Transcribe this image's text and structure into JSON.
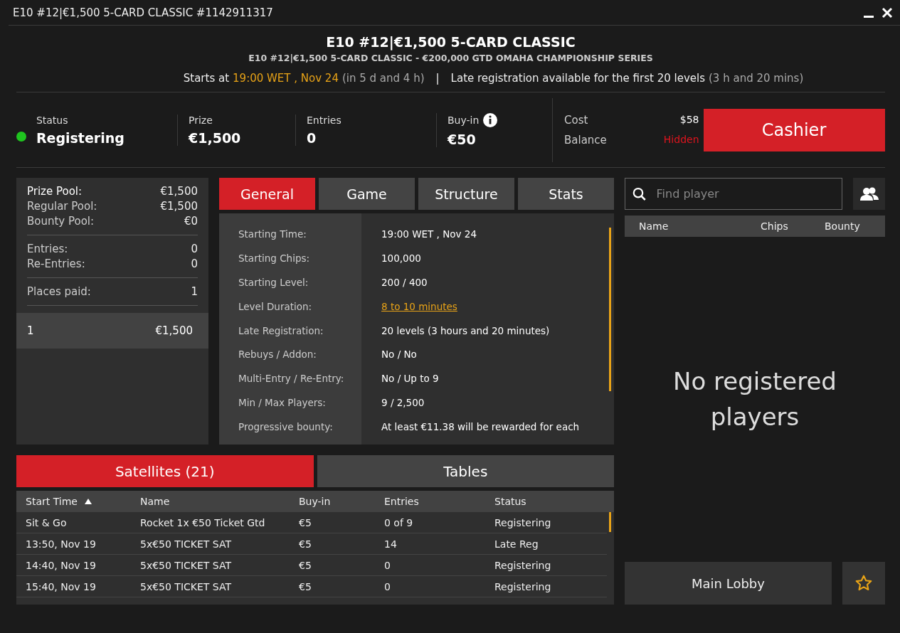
{
  "window": {
    "title": "E10 #12|€1,500 5-CARD CLASSIC #1142911317"
  },
  "header": {
    "title": "E10 #12|€1,500 5-CARD CLASSIC",
    "subtitle": "E10 #12|€1,500 5-CARD CLASSIC - €200,000 GTD OMAHA CHAMPIONSHIP SERIES",
    "starts_label": "Starts at",
    "start_time": "19:00 WET , Nov 24",
    "start_remaining": "(in 5 d and 4 h)",
    "separator": "|",
    "late_reg": "Late registration available for the first 20 levels",
    "late_reg_remaining": "(3 h and 20 mins)"
  },
  "summary": {
    "status": {
      "label": "Status",
      "value": "Registering",
      "color": "#1fc41f"
    },
    "stats": [
      {
        "label": "Prize",
        "value": "€1,500",
        "info": false
      },
      {
        "label": "Entries",
        "value": "0",
        "info": false
      },
      {
        "label": "Buy-in",
        "value": "€50",
        "info": true
      }
    ],
    "cost_label": "Cost",
    "cost_value": "$58",
    "balance_label": "Balance",
    "balance_value": "Hidden",
    "cashier": "Cashier"
  },
  "prize_panel": {
    "groups": [
      [
        {
          "label": "Prize Pool:",
          "value": "€1,500",
          "strong": true
        },
        {
          "label": "Regular Pool:",
          "value": "€1,500",
          "strong": false
        },
        {
          "label": "Bounty Pool:",
          "value": "€0",
          "strong": false
        }
      ],
      [
        {
          "label": "Entries:",
          "value": "0",
          "strong": false
        },
        {
          "label": "Re-Entries:",
          "value": "0",
          "strong": false
        }
      ],
      [
        {
          "label": "Places paid:",
          "value": "1",
          "strong": false
        }
      ]
    ],
    "payouts": [
      {
        "place": "1",
        "amount": "€1,500"
      }
    ]
  },
  "info_tabs": [
    {
      "label": "General",
      "selected": true
    },
    {
      "label": "Game",
      "selected": false
    },
    {
      "label": "Structure",
      "selected": false
    },
    {
      "label": "Stats",
      "selected": false
    }
  ],
  "details": [
    {
      "label": "Starting Time:",
      "value": "19:00 WET , Nov 24",
      "link": false
    },
    {
      "label": "Starting Chips:",
      "value": "100,000",
      "link": false
    },
    {
      "label": "Starting Level:",
      "value": "200 / 400",
      "link": false
    },
    {
      "label": "Level Duration:",
      "value": "8 to 10 minutes",
      "link": true
    },
    {
      "label": "Late Registration:",
      "value": "20 levels (3 hours and 20 minutes)",
      "link": false
    },
    {
      "label": "Rebuys / Addon:",
      "value": "No / No",
      "link": false
    },
    {
      "label": "Multi-Entry / Re-Entry:",
      "value": "No / Up to 9",
      "link": false
    },
    {
      "label": "Min / Max Players:",
      "value": "9 / 2,500",
      "link": false
    },
    {
      "label": "Progressive bounty:",
      "value": "At least €11.38 will be rewarded for each",
      "link": false
    }
  ],
  "bottom_tabs": [
    {
      "label": "Satellites (21)",
      "selected": true
    },
    {
      "label": "Tables",
      "selected": false
    }
  ],
  "satellites": {
    "columns": [
      {
        "label": "Start Time",
        "sorted": true
      },
      {
        "label": "Name",
        "sorted": false
      },
      {
        "label": "Buy-in",
        "sorted": false
      },
      {
        "label": "Entries",
        "sorted": false
      },
      {
        "label": "Status",
        "sorted": false
      }
    ],
    "rows": [
      [
        "Sit & Go",
        "Rocket 1x €50 Ticket Gtd",
        "€5",
        "0 of 9",
        "Registering"
      ],
      [
        "13:50, Nov 19",
        "5x€50 TICKET SAT",
        "€5",
        "14",
        "Late Reg"
      ],
      [
        "14:40, Nov 19",
        "5x€50 TICKET SAT",
        "€5",
        "0",
        "Registering"
      ],
      [
        "15:40, Nov 19",
        "5x€50 TICKET SAT",
        "€5",
        "0",
        "Registering"
      ]
    ]
  },
  "players": {
    "search_placeholder": "Find player",
    "columns": [
      "Name",
      "Chips",
      "Bounty"
    ],
    "empty": "No registered players",
    "main_lobby": "Main Lobby"
  }
}
